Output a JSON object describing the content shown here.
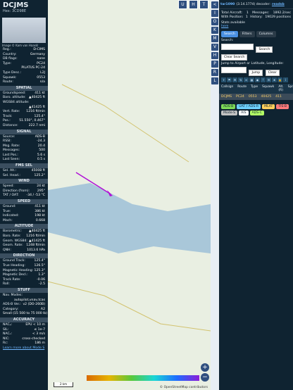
{
  "left": {
    "title": "DCJMS",
    "hex_line": "Hex: 3CD98E",
    "photo_credit": "Image © Kam van Haaskl",
    "fields": [
      {
        "label": "Reg.:",
        "value": "D-CIMS"
      },
      {
        "label": "Country:",
        "value": "Germany"
      },
      {
        "label": "DB flags:",
        "value": "none"
      },
      {
        "label": "Type:",
        "value": "PC24"
      },
      {
        "label": "",
        "value": "PILATUS PC-24"
      },
      {
        "label": "Type Desc.:",
        "value": "L2J"
      },
      {
        "label": "Squawk:",
        "value": "0553"
      },
      {
        "label": "Route:",
        "value": "n/a"
      }
    ],
    "sections": [
      {
        "name": "SPATIAL",
        "rows": [
          {
            "label": "Groundspeed:",
            "value": "411 kt"
          },
          {
            "label": "Baro. altitude:",
            "value": "▲40425 ft"
          },
          {
            "label": "WGS84 altitude:",
            "value": ""
          },
          {
            "label": "",
            "value": "▲41425 ft"
          },
          {
            "label": "Vert. Rate:",
            "value": "1216 ft/min"
          },
          {
            "label": "Track:",
            "value": "125.4°"
          },
          {
            "label": "Pos.:",
            "value": "51.550°, 0.467°"
          },
          {
            "label": "Distance:",
            "value": "222.7 nmi"
          }
        ]
      },
      {
        "name": "SIGNAL",
        "rows": [
          {
            "label": "Source:",
            "value": "ADS-B"
          },
          {
            "label": "RSSI:",
            "value": "-24.3"
          },
          {
            "label": "Msg. Rate:",
            "value": "20.4"
          },
          {
            "label": "Messages:",
            "value": "500"
          },
          {
            "label": "Last Pos.:",
            "value": "5.6 s"
          },
          {
            "label": "Last Seen:",
            "value": "0.5 s"
          }
        ]
      },
      {
        "name": "FMS SEL",
        "rows": [
          {
            "label": "Sel. Alt.:",
            "value": "45008 ft"
          },
          {
            "label": "Sel. Head.:",
            "value": "125.2°"
          }
        ]
      },
      {
        "name": "WIND",
        "rows": [
          {
            "label": "Speed:",
            "value": "24 kt"
          },
          {
            "label": "Direction (from):",
            "value": "295°"
          },
          {
            "label": "TAT / OAT:",
            "value": "-34 / -53 °C"
          }
        ]
      },
      {
        "name": "SPEED",
        "rows": [
          {
            "label": "Ground:",
            "value": "411 kt"
          },
          {
            "label": "True:",
            "value": "386 kt"
          },
          {
            "label": "Indicated:",
            "value": "198 kt"
          },
          {
            "label": "Mach:",
            "value": "0.668"
          }
        ]
      },
      {
        "name": "ALTITUDE",
        "rows": [
          {
            "label": "Barometric:",
            "value": "▲40425 ft"
          },
          {
            "label": "Baro. Rate:",
            "value": "1216 ft/min"
          },
          {
            "label": "Geom. WGS84:",
            "value": "▲41425 ft"
          },
          {
            "label": "Geom. Rate:",
            "value": "1248 ft/min"
          },
          {
            "label": "QNH:",
            "value": "1013.6 hPa"
          }
        ]
      },
      {
        "name": "DIRECTION",
        "rows": [
          {
            "label": "Ground Track:",
            "value": "125.4°"
          },
          {
            "label": "True Heading:",
            "value": "126.5°"
          },
          {
            "label": "Magnetic Heading:",
            "value": "125.3°"
          },
          {
            "label": "Magnetic Decl.:",
            "value": "1.3°"
          },
          {
            "label": "Track Rate:",
            "value": "-0.06"
          },
          {
            "label": "Roll:",
            "value": "-2.5"
          }
        ]
      },
      {
        "name": "STUFF",
        "rows": [
          {
            "label": "Nav. Modes:",
            "value": ""
          },
          {
            "label": "",
            "value": "autopilot,vnav,tcas"
          },
          {
            "label": "ADS-B Ver.:",
            "value": "v2 (DO-260B)"
          },
          {
            "label": "Category:",
            "value": "A2"
          },
          {
            "label": "",
            "value": "Small (15 500 to 75 000 lb)"
          }
        ]
      },
      {
        "name": "ACCURACY",
        "rows": [
          {
            "label": "NACₚ:",
            "value": "EPU < 10 m"
          },
          {
            "label": "SIL:",
            "value": "≤ 1e-7"
          },
          {
            "label": "NACᵥ:",
            "value": "< 3 m/s"
          },
          {
            "label": "NIC:",
            "value": "cross-checked"
          },
          {
            "label": "Rc:",
            "value": "186 m"
          }
        ]
      }
    ],
    "footer": "Learn more about Mode S"
  },
  "map": {
    "top_buttons": [
      "U",
      "H",
      "T"
    ],
    "zoom_in": "+",
    "zoom_out": "−",
    "scale_label": "2 km",
    "attribution": "© OpenStreetMap contributors"
  },
  "side_buttons": [
    "<",
    "I",
    "O",
    "K",
    "M",
    "V",
    "H",
    "P",
    "R",
    "L"
  ],
  "right": {
    "header_prefix": "tar1090",
    "header_suffix": "(3.14.1774) decoder:",
    "header_link": "readsb",
    "stats": [
      {
        "label": "Total Aircraft:",
        "value": "1",
        "label2": "Messages:",
        "value2": "1892.2/sec"
      },
      {
        "label": "With Position:",
        "value": "1",
        "label2": "History:",
        "value2": "19029 positions"
      }
    ],
    "stats_available": "Stats available",
    "stats_link": "here",
    "tabs": [
      "Search",
      "Filters",
      "Columns"
    ],
    "search_label": "Search:",
    "search_button": "Search",
    "clear_search": "Clear Search",
    "jump_label": "Jump to Airport or Latitude, Longitude:",
    "jump_button": "Jump",
    "clear_button": "Clear",
    "toolbar_icons": [
      "share-icon",
      "filter-icon",
      "settings-icon",
      "sort-icon",
      "layers-icon",
      "map-icon",
      "globe-icon",
      "alert-icon",
      "list-icon",
      "star-icon",
      "lock-icon",
      "info-icon"
    ],
    "list_headers": [
      "Callsign",
      "Route",
      "Type",
      "Squawk",
      "Alt. (ft)",
      "Spd"
    ],
    "list_row": {
      "callsign": "DCJMS",
      "type": "PC24",
      "squawk": "0553",
      "alt": "40425",
      "spd": "411"
    },
    "legend": [
      {
        "label": "ADS-B",
        "color": "#7ed957"
      },
      {
        "label": "UAT / ADS-R",
        "color": "#6ed1ff"
      },
      {
        "label": "MLAT",
        "color": "#ffcf5c"
      },
      {
        "label": "TIS-B",
        "color": "#ff7b7b"
      },
      {
        "label": "Mode-S",
        "color": "#c2c2c2"
      },
      {
        "label": "AIS",
        "color": "#ffffff"
      },
      {
        "label": "ADS-C",
        "color": "#b3ff66"
      }
    ]
  },
  "colors": {
    "panel": "#0f2331",
    "accent": "#4a90e2",
    "link": "#6fb7ff",
    "track": "#b011d6"
  }
}
